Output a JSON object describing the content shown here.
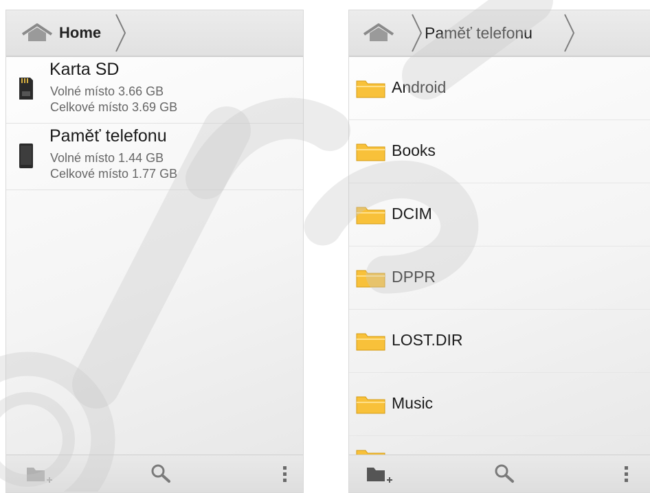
{
  "left_screen": {
    "breadcrumb": {
      "home_label": "Home"
    },
    "volumes": [
      {
        "name": "Karta SD",
        "free": "Volné místo 3.66 GB",
        "total": "Celkové místo 3.69 GB",
        "icon": "sd-card-icon"
      },
      {
        "name": "Paměť telefonu",
        "free": "Volné místo 1.44 GB",
        "total": "Celkové místo 1.77 GB",
        "icon": "phone-storage-icon"
      }
    ],
    "toolbar": {
      "new_folder_icon": "new-folder-icon",
      "search_icon": "search-icon",
      "menu_icon": "overflow-menu-icon"
    }
  },
  "right_screen": {
    "breadcrumb": {
      "current_label": "Paměť telefonu"
    },
    "folders": [
      {
        "name": "Android"
      },
      {
        "name": "Books"
      },
      {
        "name": "DCIM"
      },
      {
        "name": "DPPR"
      },
      {
        "name": "LOST.DIR"
      },
      {
        "name": "Music"
      }
    ],
    "toolbar": {
      "new_folder_icon": "new-folder-icon",
      "search_icon": "search-icon",
      "menu_icon": "overflow-menu-icon"
    }
  },
  "colors": {
    "folder_fill": "#f8c13a",
    "folder_edge": "#d39a12",
    "watermark": "#dcdcdc"
  }
}
